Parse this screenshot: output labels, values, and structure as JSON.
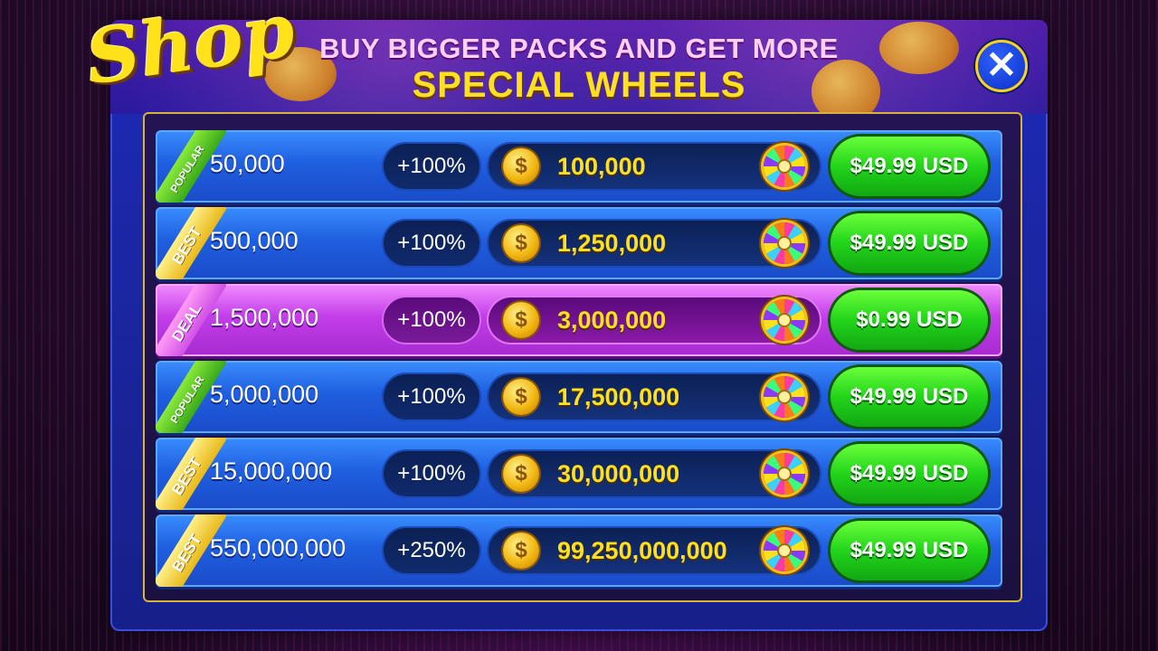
{
  "header": {
    "title": "Shop",
    "headline_line1": "BUY BIGGER PACKS AND GET MORE",
    "headline_line2": "SPECIAL WHEELS",
    "close_glyph": "✕"
  },
  "coin_glyph": "$",
  "colors": {
    "panel_blue": "#1d2ab8",
    "row_blue": "#1f5fe0",
    "row_deal": "#c23ee8",
    "buy_green": "#22d41a",
    "gold": "#ffe020"
  },
  "icons": [
    "close-icon",
    "coin-icon",
    "wheel-icon"
  ],
  "packs": [
    {
      "badge": "POPULAR",
      "badge_style": "popular",
      "base": "50,000",
      "bonus": "+100%",
      "total": "100,000",
      "price": "$49.99 USD",
      "highlight": false
    },
    {
      "badge": "BEST",
      "badge_style": "best",
      "base": "500,000",
      "bonus": "+100%",
      "total": "1,250,000",
      "price": "$49.99 USD",
      "highlight": false
    },
    {
      "badge": "DEAL",
      "badge_style": "deal",
      "base": "1,500,000",
      "bonus": "+100%",
      "total": "3,000,000",
      "price": "$0.99 USD",
      "highlight": true
    },
    {
      "badge": "POPULAR",
      "badge_style": "popular",
      "base": "5,000,000",
      "bonus": "+100%",
      "total": "17,500,000",
      "price": "$49.99 USD",
      "highlight": false
    },
    {
      "badge": "BEST",
      "badge_style": "best",
      "base": "15,000,000",
      "bonus": "+100%",
      "total": "30,000,000",
      "price": "$49.99 USD",
      "highlight": false
    },
    {
      "badge": "BEST",
      "badge_style": "best",
      "base": "550,000,000",
      "bonus": "+250%",
      "total": "99,250,000,000",
      "price": "$49.99 USD",
      "highlight": false
    }
  ]
}
